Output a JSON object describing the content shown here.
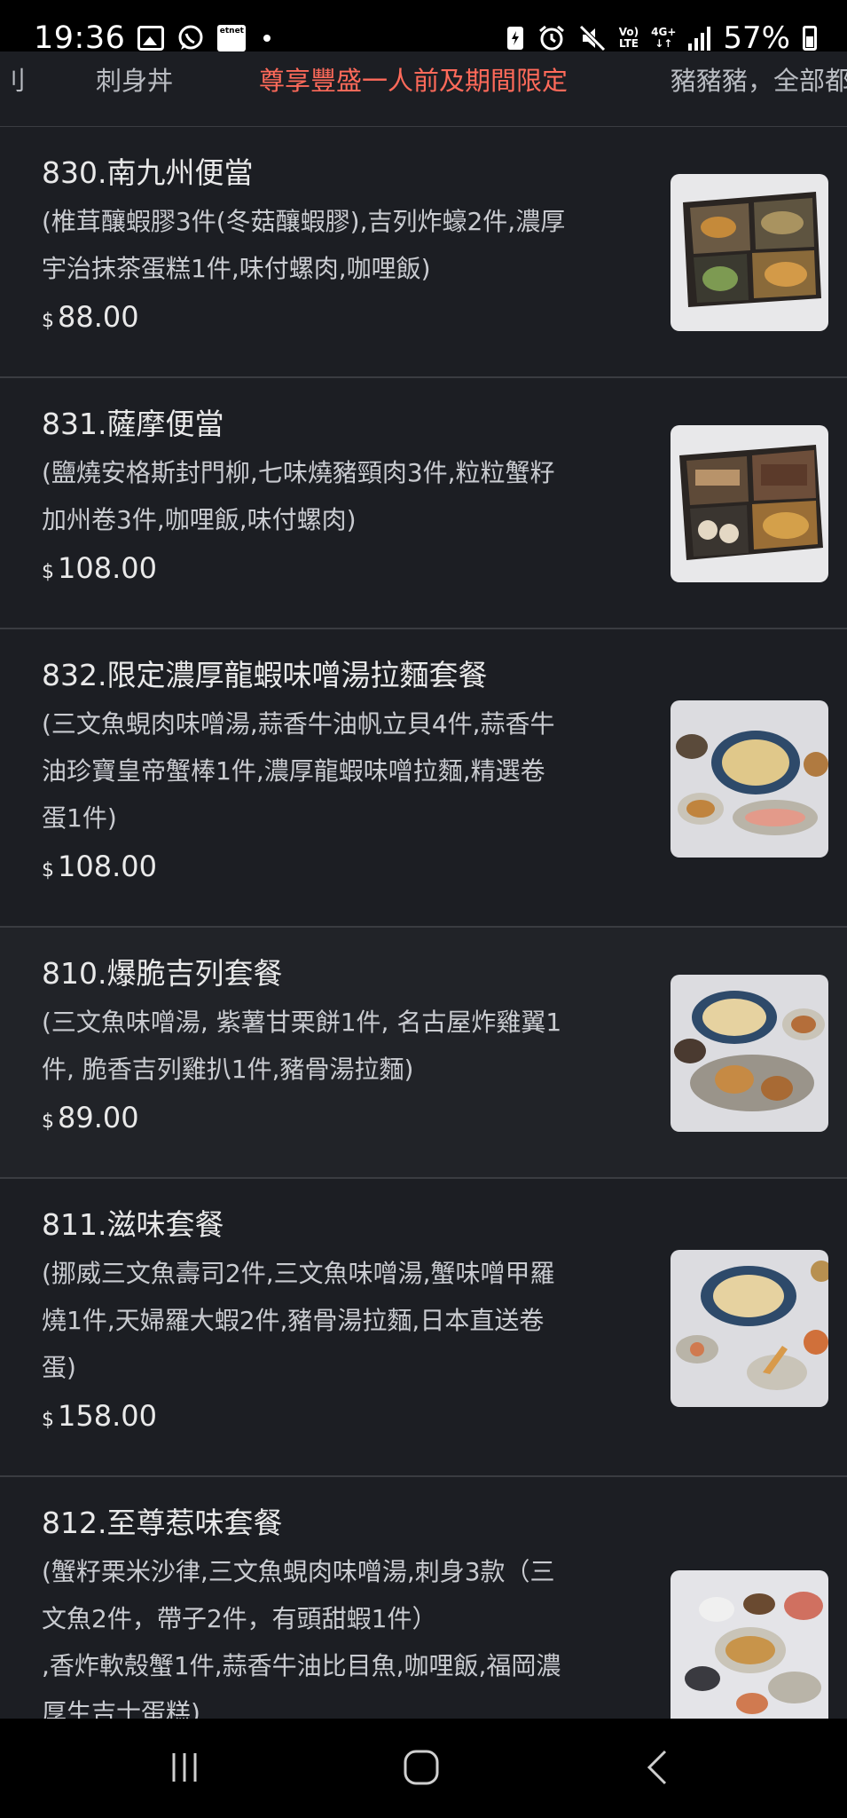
{
  "status_bar": {
    "time": "19:36",
    "icons_left": [
      "gallery-icon",
      "whatsapp-icon",
      "etnet-icon",
      "dot-icon"
    ],
    "etnet_label": "etnet",
    "volte_top": "Vo)",
    "volte_bottom": "LTE",
    "net_top": "4G+",
    "net_bottom": "↓↑",
    "battery": "57%"
  },
  "tabs": [
    {
      "label": "刂",
      "active": false
    },
    {
      "label": "刺身丼",
      "active": false
    },
    {
      "label": "尊享豐盛一人前及期間限定",
      "active": true
    },
    {
      "label": "豬豬豬，全部都",
      "active": false
    }
  ],
  "items": [
    {
      "name": "830.南九州便當",
      "desc": [
        "(椎茸釀蝦膠3件(冬菇釀蝦膠),吉列炸蠔2件,濃厚",
        "宇治抹茶蛋糕1件,味付螺肉,咖哩飯)"
      ],
      "currency": "$",
      "price": "88.00"
    },
    {
      "name": "831.薩摩便當",
      "desc": [
        "(鹽燒安格斯封門柳,七味燒豬頸肉3件,粒粒蟹籽",
        "加州卷3件,咖哩飯,味付螺肉)"
      ],
      "currency": "$",
      "price": "108.00"
    },
    {
      "name": "832.限定濃厚龍蝦味噌湯拉麵套餐",
      "desc": [
        "(三文魚蜆肉味噌湯,蒜香牛油帆立貝4件,蒜香牛",
        "油珍寶皇帝蟹棒1件,濃厚龍蝦味噌拉麵,精選卷",
        "蛋1件)"
      ],
      "currency": "$",
      "price": "108.00"
    },
    {
      "name": "810.爆脆吉列套餐",
      "desc": [
        "(三文魚味噌湯, 紫薯甘栗餅1件, 名古屋炸雞翼1",
        "件, 脆香吉列雞扒1件,豬骨湯拉麵)"
      ],
      "currency": "$",
      "price": "89.00"
    },
    {
      "name": "811.滋味套餐",
      "desc": [
        "(挪威三文魚壽司2件,三文魚味噌湯,蟹味噌甲羅",
        "燒1件,天婦羅大蝦2件,豬骨湯拉麵,日本直送卷",
        "蛋)"
      ],
      "currency": "$",
      "price": "158.00"
    },
    {
      "name": "812.至尊惹味套餐",
      "desc": [
        "(蟹籽栗米沙律,三文魚蜆肉味噌湯,刺身3款（三",
        "文魚2件，帶子2件，有頭甜蝦1件）",
        ",香炸軟殼蟹1件,蒜香牛油比目魚,咖哩飯,福岡濃",
        "厚生吉士蛋糕)"
      ],
      "currency": "$",
      "price": ""
    }
  ],
  "colors": {
    "background": "#1c1e23",
    "active_tab": "#ff6a5a",
    "divider": "#3a3c41",
    "text": "#e9e9e9"
  },
  "nav": {
    "recents": "recents-icon",
    "home": "home-icon",
    "back": "back-icon"
  }
}
